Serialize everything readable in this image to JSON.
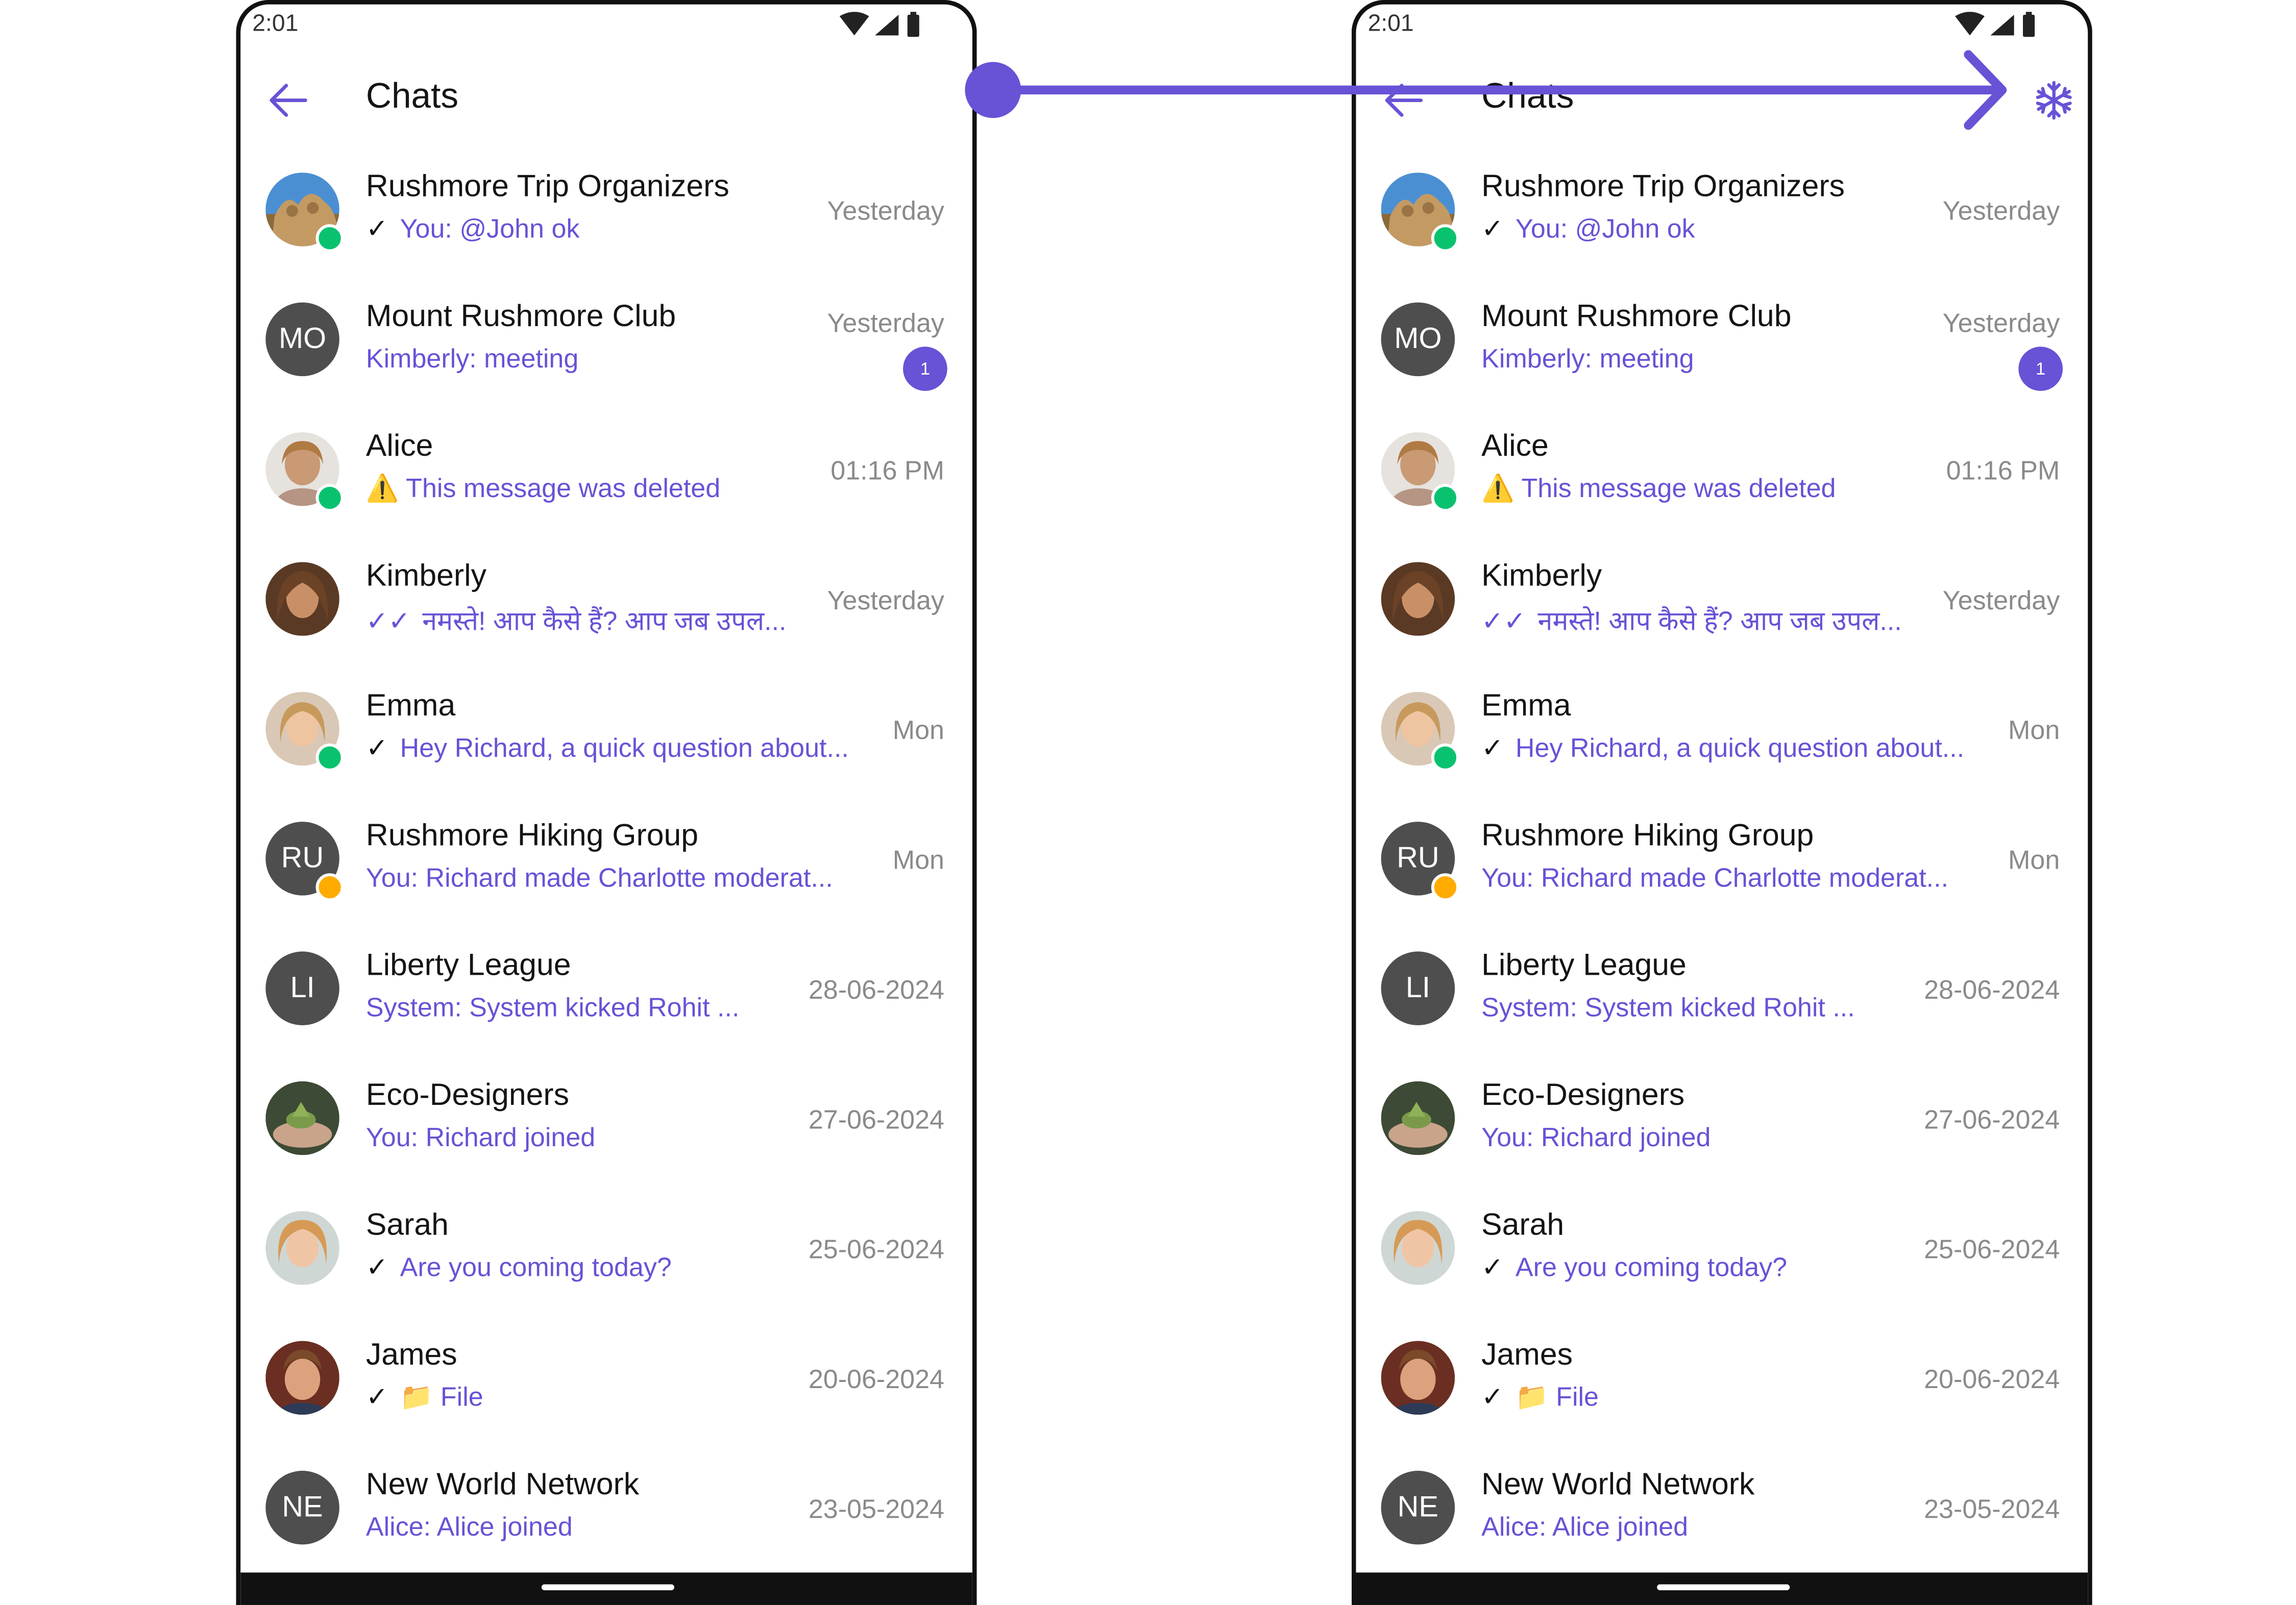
{
  "status_bar": {
    "time": "2:01"
  },
  "header": {
    "title": "Chats",
    "back_icon": "arrow-left-icon",
    "action_icon": "snowflake-icon"
  },
  "colors": {
    "accent": "#6852d6",
    "online": "#09c26f",
    "locked": "#ffab00",
    "avatar_bg": "#4e4e4e"
  },
  "conversations": [
    {
      "name": "Rushmore Trip Organizers",
      "subtitle": "You: @John ok",
      "time": "Yesterday",
      "tick": "✓",
      "avatar": "mountain-photo",
      "status": "online"
    },
    {
      "name": "Mount Rushmore Club",
      "subtitle": "Kimberly: meeting",
      "time": "Yesterday",
      "initials": "MO",
      "unread": "1"
    },
    {
      "name": "Alice",
      "subtitle": "⚠️ This message was deleted",
      "time": "01:16 PM",
      "avatar": "woman-photo",
      "status": "online"
    },
    {
      "name": "Kimberly",
      "subtitle": "नमस्ते! आप कैसे हैं? आप जब उपल...",
      "time": "Yesterday",
      "tick": "✓✓",
      "avatar": "woman-photo"
    },
    {
      "name": "Emma",
      "subtitle": "Hey Richard, a quick question about...",
      "time": "Mon",
      "tick": "✓",
      "avatar": "girl-photo",
      "status": "online"
    },
    {
      "name": "Rushmore Hiking Group",
      "subtitle": "You: Richard made Charlotte moderat...",
      "time": "Mon",
      "initials": "RU",
      "status": "locked"
    },
    {
      "name": "Liberty League",
      "subtitle": "System: System kicked Rohit ...",
      "time": "28-06-2024",
      "initials": "LI"
    },
    {
      "name": "Eco-Designers",
      "subtitle": "You: Richard joined",
      "time": "27-06-2024",
      "avatar": "plant-photo"
    },
    {
      "name": "Sarah",
      "subtitle": "Are you coming today?",
      "time": "25-06-2024",
      "tick": "✓",
      "avatar": "woman-photo"
    },
    {
      "name": "James",
      "subtitle": "📁 File",
      "time": "20-06-2024",
      "tick": "✓",
      "avatar": "man-photo"
    },
    {
      "name": "New World Network",
      "subtitle": "Alice: Alice joined",
      "time": "23-05-2024",
      "initials": "NE"
    }
  ]
}
